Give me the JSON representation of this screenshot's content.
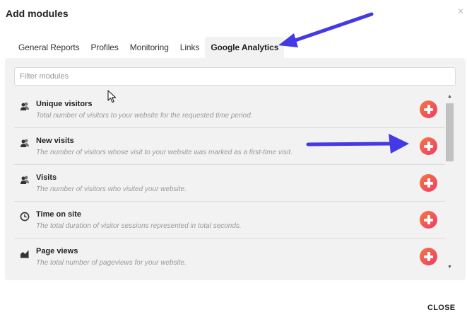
{
  "dialog": {
    "title": "Add modules",
    "close_icon": "×",
    "close_button": "CLOSE"
  },
  "tabs": [
    {
      "label": "General Reports",
      "active": false
    },
    {
      "label": "Profiles",
      "active": false
    },
    {
      "label": "Monitoring",
      "active": false
    },
    {
      "label": "Links",
      "active": false
    },
    {
      "label": "Google Analytics",
      "active": true
    }
  ],
  "filter": {
    "placeholder": "Filter modules",
    "value": ""
  },
  "modules": [
    {
      "name": "Unique visitors",
      "description": "Total number of visitors to your website for the requested time period.",
      "icon": "users-icon"
    },
    {
      "name": "New visits",
      "description": "The number of visitors whose visit to your website was marked as a first-time visit.",
      "icon": "users-icon"
    },
    {
      "name": "Visits",
      "description": "The number of visitors who visited your website.",
      "icon": "users-icon"
    },
    {
      "name": "Time on site",
      "description": "The total duration of visitor sessions represented in total seconds.",
      "icon": "clock-icon"
    },
    {
      "name": "Page views",
      "description": "The total number of pageviews for your website.",
      "icon": "area-chart-icon"
    }
  ],
  "colors": {
    "accent_gradient_start": "#f87640",
    "accent_gradient_end": "#ee3b68",
    "annotation_arrow": "#4339e6",
    "panel_background": "#f2f2f2"
  }
}
